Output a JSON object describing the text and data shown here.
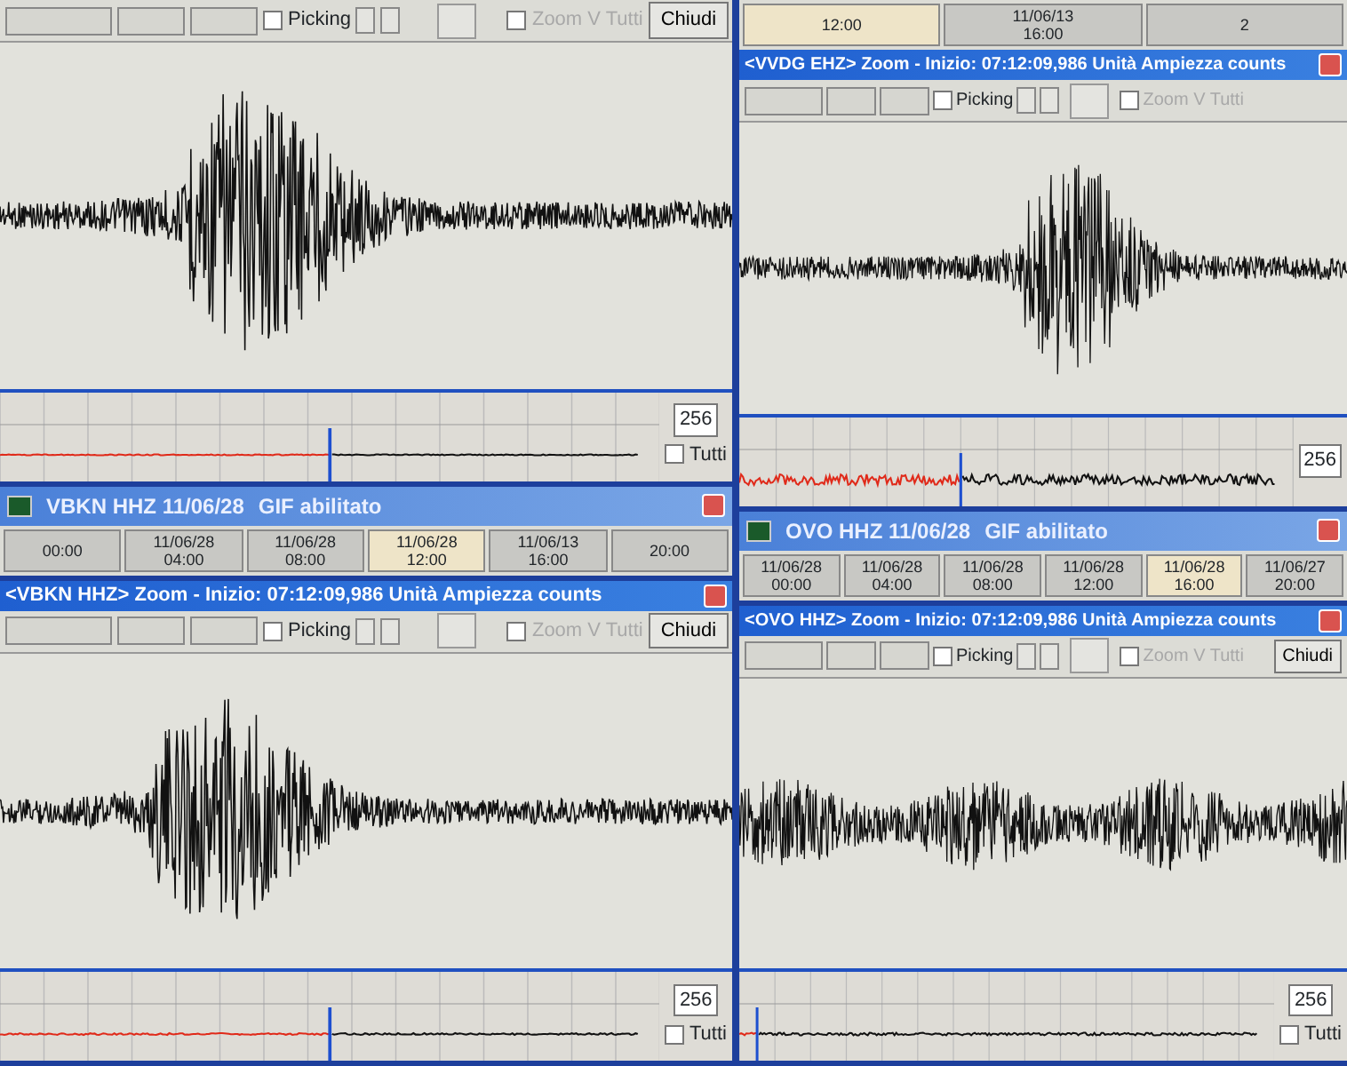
{
  "columns": [
    {
      "windows": [
        {
          "kind": "zoom",
          "picking": "Picking",
          "picking_checked": false,
          "zoom_all": {
            "label": "Zoom V Tutti",
            "checked": false,
            "disabled": true
          },
          "close_label": "Chiudi",
          "gain": "256",
          "all_toggle": {
            "label": "Tutti",
            "checked": false
          }
        },
        {
          "kind": "station",
          "title": "VBKN HHZ 11/06/28",
          "status": "GIF abilitato",
          "slots": [
            {
              "time": "00:00",
              "selected": false
            },
            {
              "date": "11/06/28",
              "time": "04:00",
              "selected": false
            },
            {
              "date": "11/06/28",
              "time": "08:00",
              "selected": false
            },
            {
              "date": "11/06/28",
              "time": "12:00",
              "selected": true
            },
            {
              "date": "11/06/13",
              "time": "16:00",
              "selected": false
            },
            {
              "time": "20:00",
              "selected": false
            }
          ]
        },
        {
          "kind": "zoom",
          "title": "<VBKN HHZ> Zoom - Inizio: 07:12:09,986 Unità Ampiezza counts",
          "picking": "Picking",
          "picking_checked": false,
          "zoom_all": {
            "label": "Zoom V Tutti",
            "checked": false,
            "disabled": true
          },
          "close_label": "Chiudi",
          "gain": "256",
          "all_toggle": {
            "label": "Tutti",
            "checked": false
          }
        }
      ]
    },
    {
      "windows": [
        {
          "kind": "timebar",
          "slots": [
            {
              "time": "12:00",
              "selected": true
            },
            {
              "date": "11/06/13",
              "time": "16:00",
              "selected": false
            },
            {
              "time": "2",
              "selected": false
            }
          ]
        },
        {
          "kind": "zoom",
          "title": "<VVDG EHZ> Zoom - Inizio: 07:12:09,986 Unità Ampiezza counts",
          "picking": "Picking",
          "picking_checked": false,
          "zoom_all": {
            "label": "Zoom V Tutti",
            "checked": false,
            "disabled": true
          },
          "gain": "256"
        },
        {
          "kind": "station",
          "title": "OVO HHZ 11/06/28",
          "status": "GIF abilitato",
          "slots": [
            {
              "date": "11/06/28",
              "time": "00:00",
              "selected": false
            },
            {
              "date": "11/06/28",
              "time": "04:00",
              "selected": false
            },
            {
              "date": "11/06/28",
              "time": "08:00",
              "selected": false
            },
            {
              "date": "11/06/28",
              "time": "12:00",
              "selected": false
            },
            {
              "date": "11/06/28",
              "time": "16:00",
              "selected": true
            },
            {
              "date": "11/06/27",
              "time": "20:00",
              "selected": false
            }
          ]
        },
        {
          "kind": "zoom",
          "title": "<OVO HHZ> Zoom - Inizio: 07:12:09,986 Unità Ampiezza counts",
          "picking": "Picking",
          "picking_checked": false,
          "zoom_all": {
            "label": "Zoom V Tutti",
            "checked": false,
            "disabled": true
          },
          "close_label": "Chiudi",
          "gain": "256",
          "all_toggle": {
            "label": "Tutti",
            "checked": false
          }
        }
      ]
    }
  ]
}
